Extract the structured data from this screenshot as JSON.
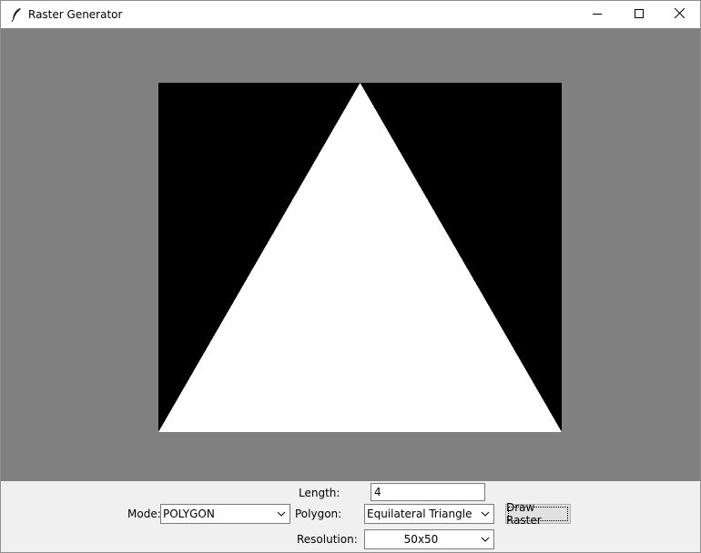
{
  "window": {
    "title": "Raster Generator",
    "icons": {
      "app": "feather-icon",
      "minimize": "minimize-icon",
      "maximize": "maximize-icon",
      "close": "close-icon"
    }
  },
  "canvas": {
    "background_color": "#808080",
    "raster_background": "#000000",
    "shape_color": "#ffffff",
    "shape": "equilateral-triangle"
  },
  "controls": {
    "length_label": "Length:",
    "length_value": "4",
    "mode_label": "Mode:",
    "mode_value": "POLYGON",
    "polygon_label": "Polygon:",
    "polygon_value": "Equilateral Triangle",
    "draw_button": "Draw Raster",
    "resolution_label": "Resolution:",
    "resolution_value": "50x50"
  }
}
